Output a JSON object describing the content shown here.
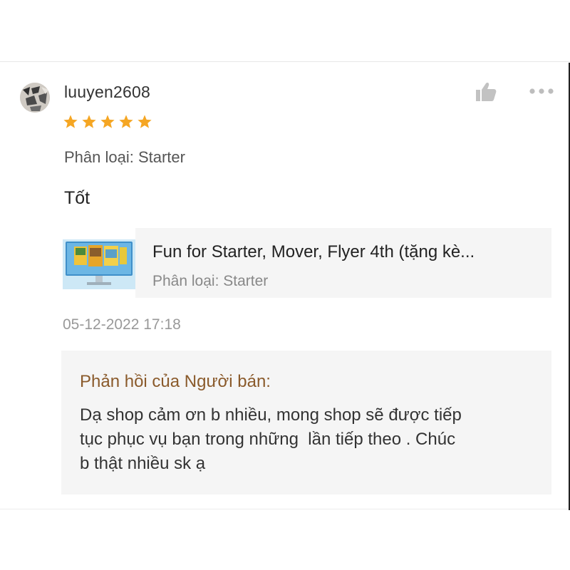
{
  "review": {
    "username": "luuyen2608",
    "rating": 5,
    "rating_max": 5,
    "star_color": "#f5a623",
    "variation_text": "Phân loại: Starter",
    "comment": "Tốt",
    "timestamp": "05-12-2022 17:18"
  },
  "product": {
    "title": "Fun for Starter, Mover, Flyer 4th (tặng kè...",
    "variation_text": "Phân loại: Starter"
  },
  "seller_reply": {
    "label": "Phản hồi của Người bán:",
    "text": "Dạ shop cảm ơn b nhiều, mong shop sẽ được tiếp\ntục phục vụ bạn trong những  lần tiếp theo . Chúc\nb thật nhiều sk ạ",
    "label_color": "#8a5a2b"
  },
  "icons": {
    "like": "thumbs-up-icon",
    "more": "more-options-icon",
    "star": "star-icon"
  }
}
